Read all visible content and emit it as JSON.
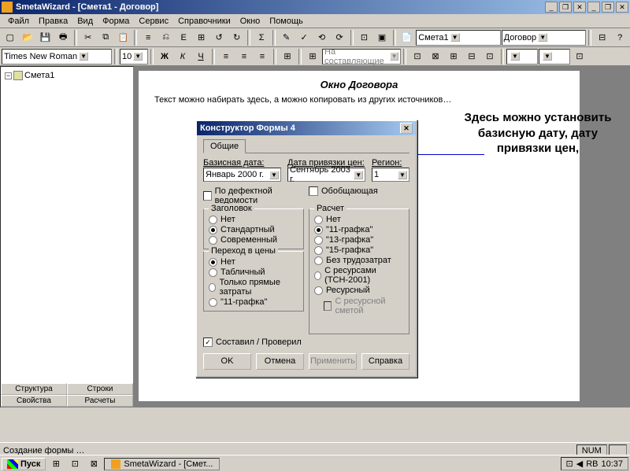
{
  "window": {
    "title": "SmetaWizard - [Смета1 - Договор]",
    "menu": [
      "Файл",
      "Правка",
      "Вид",
      "Форма",
      "Сервис",
      "Справочники",
      "Окно",
      "Помощь"
    ]
  },
  "toolbar_selects": {
    "doc1": "Смета1",
    "doc2": "Договор"
  },
  "format": {
    "font": "Times New Roman",
    "size": "10",
    "na_btn": "На составляющие"
  },
  "tree": {
    "root": "Смета1"
  },
  "sidetabs": [
    "Структура",
    "Строки",
    "Свойства",
    "Расчеты"
  ],
  "document": {
    "title": "Окно Договора",
    "text": "Текст можно набирать здесь, а можно копировать из других источников…"
  },
  "annotation": "Здесь можно установить базисную дату, дату привязки цен,",
  "dialog": {
    "title": "Конструктор Формы 4",
    "tab": "Общие",
    "labels": {
      "base": "Базисная дата:",
      "bind": "Дата привязки цен:",
      "region": "Регион:"
    },
    "base_date": "Январь   2000 г.",
    "bind_date": "Сентябрь 2003 г.",
    "region": "1",
    "chk_defect": "По дефектной ведомости",
    "chk_general": "Обобщающая",
    "group_header": "Заголовок",
    "hdr_opts": [
      "Нет",
      "Стандартный",
      "Современный"
    ],
    "group_calc": "Расчет",
    "calc_opts": [
      "Нет",
      "\"11-графка\"",
      "\"13-графка\"",
      "\"15-графка\"",
      "Без трудозатрат",
      "С ресурсами (ТСН-2001)",
      "Ресурсный"
    ],
    "calc_sub": "С ресурсной сметой",
    "group_price": "Переход в цены",
    "price_opts": [
      "Нет",
      "Табличный",
      "Только прямые затраты",
      "\"11-графка\""
    ],
    "chk_signed": "Составил / Проверил",
    "btn_ok": "OK",
    "btn_cancel": "Отмена",
    "btn_apply": "Применить",
    "btn_help": "Справка"
  },
  "status": {
    "text": "Создание формы …",
    "num": "NUM"
  },
  "taskbar": {
    "start": "Пуск",
    "task": "SmetaWizard - [Смет...",
    "lang": "RB",
    "time": "10:37"
  }
}
